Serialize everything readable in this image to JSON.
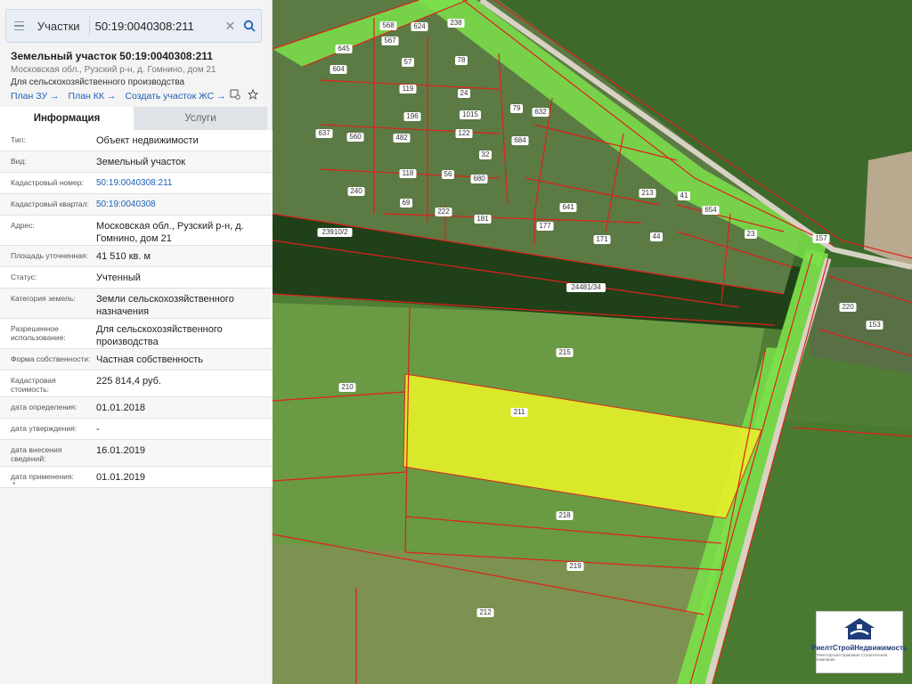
{
  "search": {
    "type_label": "Участки",
    "value": "50:19:0040308:211"
  },
  "object": {
    "title": "Земельный участок 50:19:0040308:211",
    "address": "Московская обл., Рузский р-н, д. Гомнино, дом 21",
    "purpose": "Для сельскохозяйственного производства"
  },
  "links": {
    "plan_zu": "План ЗУ →",
    "plan_kk": "План КК →",
    "create": "Создать участок ЖС →"
  },
  "tabs": [
    "Информация",
    "Услуги"
  ],
  "properties": [
    {
      "key": "Тип:",
      "value": "Объект недвижимости"
    },
    {
      "key": "Вид:",
      "value": "Земельный участок"
    },
    {
      "key": "Кадастровый номер:",
      "value": "50:19:0040308:211"
    },
    {
      "key": "Кадастровый квартал:",
      "value": "50:19:0040308"
    },
    {
      "key": "Адрес:",
      "value": "Московская обл., Рузский р-н, д. Гомнино, дом 21"
    },
    {
      "key": "Площадь уточненная:",
      "value": "41 510 кв. м"
    },
    {
      "key": "Статус:",
      "value": "Учтенный"
    },
    {
      "key": "Категория земель:",
      "value": "Земли сельскохозяйственного назначения"
    },
    {
      "key": "Разрешенное использование:",
      "value": "Для сельскохозяйственного производства"
    },
    {
      "key": "Форма собственности:",
      "value": "Частная собственность"
    },
    {
      "key": "Кадастровая стоимость:",
      "value": "225 814,4 руб."
    },
    {
      "key": "дата определения:",
      "value": "01.01.2018"
    },
    {
      "key": "дата утверждения:",
      "value": "-"
    },
    {
      "key": "дата внесения сведений:",
      "value": "16.01.2019"
    },
    {
      "key": "дата применения:",
      "value": "01.01.2019"
    }
  ],
  "map_labels": [
    "568",
    "567",
    "624",
    "238",
    "645",
    "57",
    "604",
    "78",
    "119",
    "24",
    "1015",
    "196",
    "79",
    "637",
    "560",
    "684",
    "122",
    "482",
    "632",
    "32",
    "118",
    "56",
    "680",
    "240",
    "69",
    "222",
    "181",
    "641",
    "213",
    "41",
    "654",
    "177",
    "171",
    "44",
    "23",
    "23910/2",
    "24481/34",
    "215",
    "210",
    "211",
    "218",
    "219",
    "212",
    "220",
    "153",
    "157",
    "23411"
  ],
  "logo": {
    "name": "РиелтСтройНедвижимость",
    "sub": "Риелторская Правовая Строительная Компания"
  },
  "colors": {
    "highlight_parcel": "#e4ef2a",
    "road_zone": "#7be04a",
    "boundary": "#e0201c",
    "link": "#1d5fb8"
  }
}
